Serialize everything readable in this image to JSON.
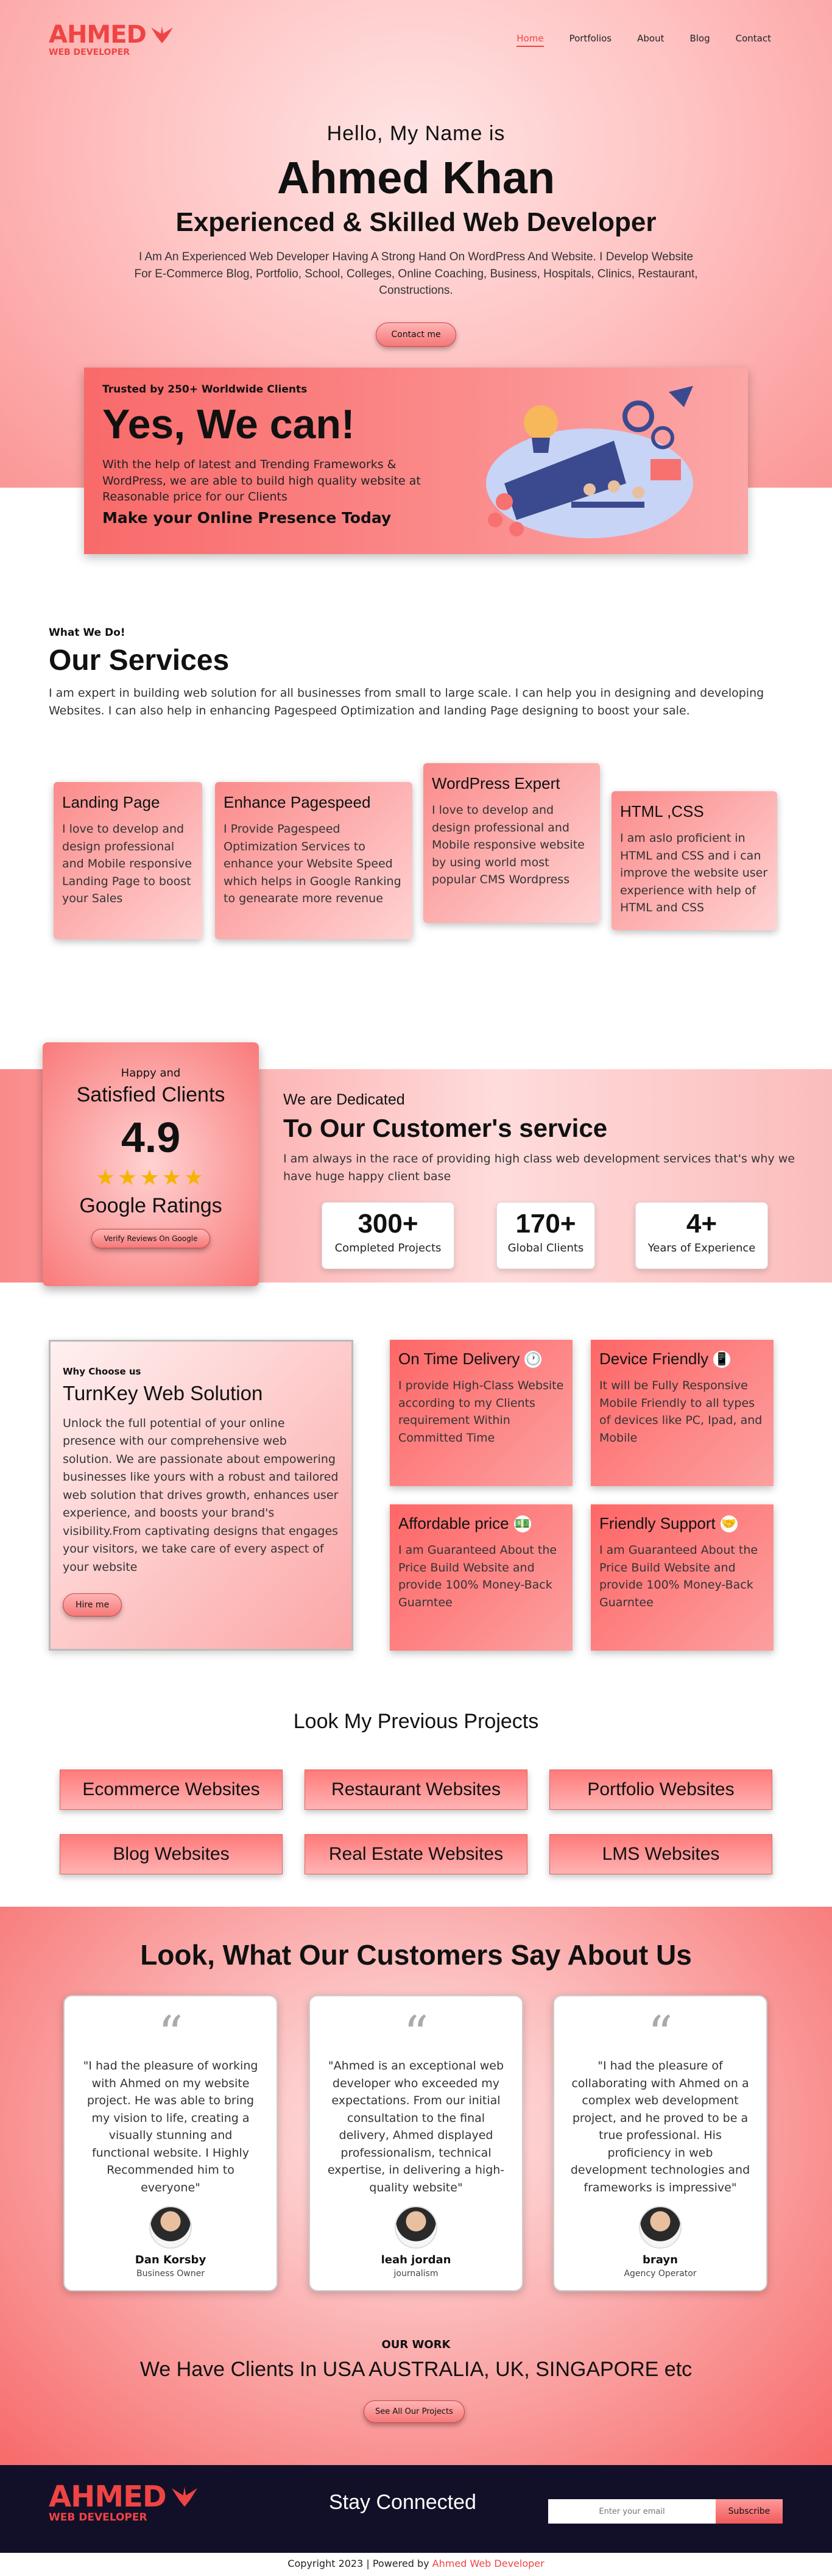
{
  "header": {
    "logo_name": "AHMED",
    "logo_sub": "WEB DEVELOPER",
    "nav": [
      "Home",
      "Portfolios",
      "About",
      "Blog",
      "Contact"
    ]
  },
  "hero": {
    "greeting": "Hello, My Name is",
    "name": "Ahmed Khan",
    "role": "Experienced & Skilled Web Developer",
    "description": "I Am An Experienced Web Developer Having A Strong Hand On WordPress And Website. I Develop Website For E-Commerce Blog, Portfolio, School, Colleges, Online Coaching, Business, Hospitals, Clinics, Restaurant, Constructions.",
    "cta": "Contact me"
  },
  "banner": {
    "eyebrow": "Trusted by 250+ Worldwide Clients",
    "title": "Yes, We can!",
    "description": "With the help of latest and Trending Frameworks & WordPress, we are able to build high quality website at Reasonable price for our Clients",
    "cta": "Make your Online Presence Today"
  },
  "services": {
    "eyebrow": "What We Do!",
    "title": "Our Services",
    "description": "I am expert in building web solution for all businesses from small to large scale. I can help you in designing and developing Websites. I can also help in enhancing Pagespeed Optimization and landing Page designing to boost your sale.",
    "cards": [
      {
        "title": "Landing Page",
        "text": "I love to develop and design professional and Mobile responsive Landing Page to boost your Sales"
      },
      {
        "title": "Enhance Pagespeed",
        "text": "I Provide Pagespeed Optimization Services to enhance your Website Speed which helps in Google Ranking to genearate more revenue"
      },
      {
        "title": "WordPress Expert",
        "text": "I love to develop and design professional and Mobile responsive website by using world most popular CMS Wordpress"
      },
      {
        "title": "HTML ,CSS",
        "text": "I am aslo proficient in HTML and CSS and i can improve the website user experience with help of HTML and CSS"
      }
    ]
  },
  "rating": {
    "happy": "Happy and",
    "satisfied": "Satisfied Clients",
    "score": "4.9",
    "stars": "★★★★★",
    "google": "Google Ratings",
    "button": "Verify Reviews On Google"
  },
  "dedicated": {
    "eyebrow": "We are Dedicated",
    "title": "To Our Customer's service",
    "description": "I am always in the race of providing high class web development services that's why we have huge happy client base",
    "stats": [
      {
        "value": "300+",
        "label": "Completed Projects"
      },
      {
        "value": "170+",
        "label": "Global Clients"
      },
      {
        "value": "4+",
        "label": "Years of Experience"
      }
    ]
  },
  "turnkey": {
    "eyebrow": "Why Choose us",
    "title": "TurnKey Web Solution",
    "text": "Unlock the full potential of your online presence with our comprehensive web solution. We are passionate about empowering businesses like yours with a robust and tailored web solution that drives growth, enhances user experience, and boosts your brand's visibility.From captivating designs that engages your visitors, we take care of every aspect of your website",
    "button": "Hire me",
    "features": [
      {
        "title": "On Time Delivery",
        "icon": "clock-icon",
        "glyph": "🕐",
        "text": "I provide High-Class Website according to my Clients requirement Within Committed Time"
      },
      {
        "title": "Device Friendly",
        "icon": "mobile-icon",
        "glyph": "📱",
        "text": "It will be Fully Responsive Mobile Friendly to all types of devices like PC, Ipad, and Mobile"
      },
      {
        "title": "Affordable price",
        "icon": "money-icon",
        "glyph": "💵",
        "text": "I am Guaranteed About the Price Build Website and provide 100% Money-Back Guarntee"
      },
      {
        "title": "Friendly Support",
        "icon": "handshake-icon",
        "glyph": "🤝",
        "text": "I am Guaranteed About the Price Build Website and provide 100% Money-Back Guarntee"
      }
    ]
  },
  "projects": {
    "title": "Look My Previous Projects",
    "items": [
      "Ecommerce Websites",
      "Restaurant Websites",
      "Portfolio Websites",
      "Blog Websites",
      "Real Estate Websites",
      "LMS Websites"
    ]
  },
  "testimonials": {
    "title": "Look, What Our Customers Say About Us",
    "items": [
      {
        "text": "\"I had the pleasure of working with Ahmed on my website project. He was able to bring my vision to life, creating a visually stunning and functional website. I Highly Recommended him to everyone\"",
        "name": "Dan Korsby",
        "role": "Business Owner"
      },
      {
        "text": "\"Ahmed is an exceptional web developer who exceeded my expectations. From our initial consultation to the final delivery, Ahmed displayed professionalism, technical expertise, in delivering a high-quality website\"",
        "name": "leah jordan",
        "role": "journalism"
      },
      {
        "text": "\"I had the pleasure of collaborating with Ahmed on a complex web development project, and he proved to be a true professional. His proficiency in web development technologies and frameworks is impressive\"",
        "name": "brayn",
        "role": "Agency Operator"
      }
    ]
  },
  "ourwork": {
    "eyebrow": "OUR WORK",
    "title": "We Have Clients In USA AUSTRALIA, UK, SINGAPORE etc",
    "button": "See All Our Projects"
  },
  "footer": {
    "title": "Stay Connected",
    "email_placeholder": "Enter your email",
    "subscribe": "Subscribe",
    "copyright": "Copyright 2023 | Powered by",
    "brand": "Ahmed Web Developer"
  },
  "colors": {
    "accent": "#ef4444",
    "footer_bg": "#121028"
  }
}
